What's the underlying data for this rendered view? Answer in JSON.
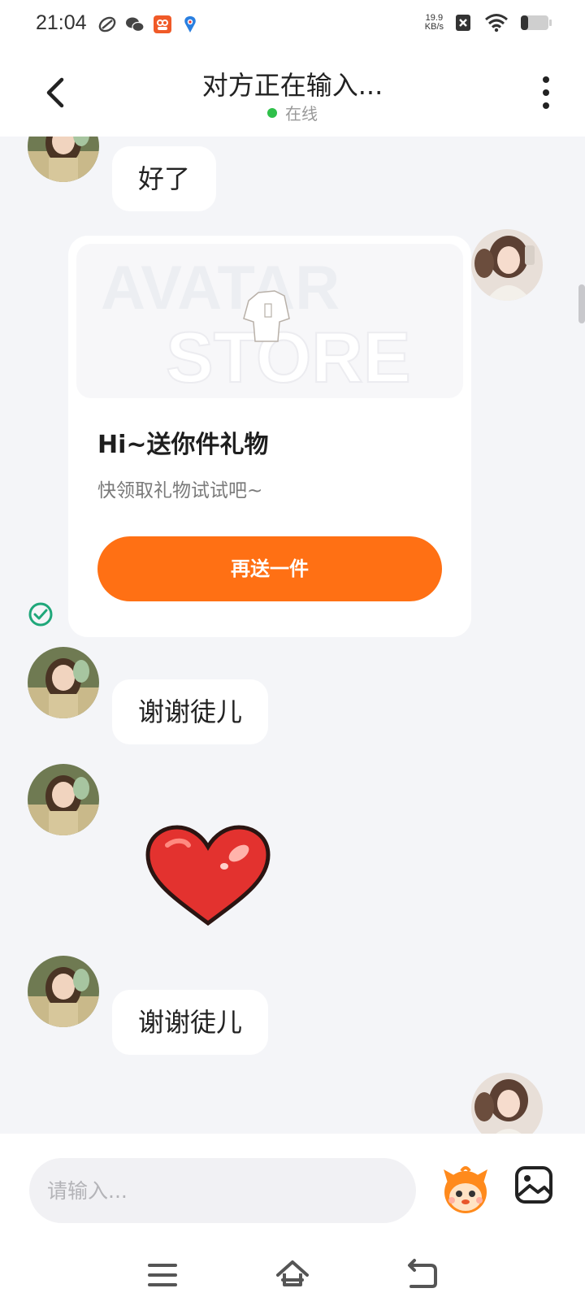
{
  "status_bar": {
    "time": "21:04",
    "net_speed_value": "19.9",
    "net_speed_unit": "KB/s",
    "icons": [
      "link-icon",
      "wechat-icon",
      "app-icon",
      "location-icon",
      "sim-off-icon",
      "wifi-icon",
      "battery-icon"
    ]
  },
  "header": {
    "title": "对方正在输入...",
    "status": "在线",
    "status_color": "#2fc04a"
  },
  "messages": [
    {
      "side": "left",
      "text": "好了"
    },
    {
      "side": "right",
      "type": "gift-card",
      "banner_text_1": "AVATAR",
      "banner_text_2": "STORE",
      "title": "Hi~送你件礼物",
      "subtitle": "快领取礼物试试吧~",
      "button": "再送一件"
    },
    {
      "side": "left",
      "text": "谢谢徒儿"
    },
    {
      "side": "left",
      "type": "sticker",
      "sticker": "heart-sticker"
    },
    {
      "side": "left",
      "text": "谢谢徒儿"
    }
  ],
  "input": {
    "placeholder": "请输入..."
  },
  "colors": {
    "accent": "#ff7014",
    "online": "#2fc04a",
    "sent_check": "#1fa77a",
    "background": "#f4f5f8"
  },
  "nav_icons": [
    "menu-icon",
    "home-icon",
    "back-nav-icon"
  ]
}
